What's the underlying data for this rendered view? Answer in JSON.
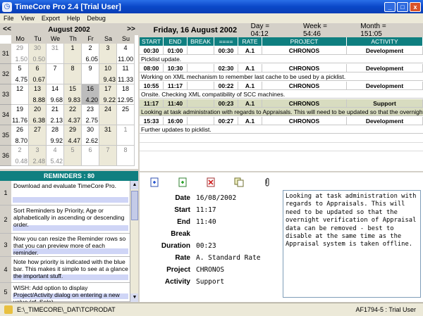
{
  "window": {
    "title": "TimeCore Pro 2.4  [Trial User]",
    "min_glyph": "_",
    "max_glyph": "□",
    "close_glyph": "x"
  },
  "menu": [
    "File",
    "View",
    "Export",
    "Help",
    "Debug"
  ],
  "calendar": {
    "prev": "<<",
    "next": ">>",
    "month": "August 2002",
    "dow": [
      "Mo",
      "Tu",
      "We",
      "Th",
      "Fr",
      "Sa",
      "Su"
    ],
    "weeks": [
      {
        "num": "31",
        "days": [
          {
            "d": "29",
            "h": "1.50",
            "other": true
          },
          {
            "d": "30",
            "h": "0.50",
            "other": true
          },
          {
            "d": "31",
            "h": "",
            "other": true
          },
          {
            "d": "1",
            "h": ""
          },
          {
            "d": "2",
            "h": "6.05"
          },
          {
            "d": "3",
            "h": ""
          },
          {
            "d": "4",
            "h": "11.00"
          }
        ]
      },
      {
        "num": "32",
        "days": [
          {
            "d": "5",
            "h": "4.75"
          },
          {
            "d": "6",
            "h": "0.67"
          },
          {
            "d": "7",
            "h": ""
          },
          {
            "d": "8",
            "h": ""
          },
          {
            "d": "9",
            "h": ""
          },
          {
            "d": "10",
            "h": "9.43"
          },
          {
            "d": "11",
            "h": "11.33"
          }
        ]
      },
      {
        "num": "33",
        "days": [
          {
            "d": "12",
            "h": ""
          },
          {
            "d": "13",
            "h": "8.88"
          },
          {
            "d": "14",
            "h": "9.68"
          },
          {
            "d": "15",
            "h": "9.83"
          },
          {
            "d": "16",
            "h": "4.20",
            "sel": true
          },
          {
            "d": "17",
            "h": "9.22"
          },
          {
            "d": "18",
            "h": "12.95"
          }
        ]
      },
      {
        "num": "34",
        "days": [
          {
            "d": "19",
            "h": "11.76"
          },
          {
            "d": "20",
            "h": "6.38"
          },
          {
            "d": "21",
            "h": "2.13"
          },
          {
            "d": "22",
            "h": "4.37"
          },
          {
            "d": "23",
            "h": "2.75"
          },
          {
            "d": "24",
            "h": ""
          },
          {
            "d": "25",
            "h": ""
          }
        ]
      },
      {
        "num": "35",
        "days": [
          {
            "d": "26",
            "h": "8.70"
          },
          {
            "d": "27",
            "h": ""
          },
          {
            "d": "28",
            "h": "9.92"
          },
          {
            "d": "29",
            "h": "4.47"
          },
          {
            "d": "30",
            "h": "2.62"
          },
          {
            "d": "31",
            "h": ""
          },
          {
            "d": "1",
            "h": "",
            "other": true
          }
        ]
      },
      {
        "num": "36",
        "days": [
          {
            "d": "2",
            "h": "0.48",
            "other": true
          },
          {
            "d": "3",
            "h": "2.48",
            "other": true
          },
          {
            "d": "4",
            "h": "5.42",
            "other": true
          },
          {
            "d": "5",
            "h": "",
            "other": true
          },
          {
            "d": "6",
            "h": "",
            "other": true
          },
          {
            "d": "7",
            "h": "",
            "other": true
          },
          {
            "d": "8",
            "h": "",
            "other": true
          }
        ]
      }
    ]
  },
  "reminders": {
    "header": "REMINDERS : 80",
    "items": [
      {
        "num": "1",
        "text": "Download and evaluate TimeCore Pro."
      },
      {
        "num": "2",
        "text": "Sort Reminders by Priority, Age or alphabetically in ascending or descending order."
      },
      {
        "num": "3",
        "text": "Now you can resize the Reminder rows so that you can preview more of each reminder."
      },
      {
        "num": "4",
        "text": "Note how priority is indicated with the blue bar. This makes it simple to see at a glance the important stuff."
      },
      {
        "num": "5",
        "text": "WISH: Add option to display Project/Activity dialog on entering a new value (cf. Solo)."
      }
    ]
  },
  "day": {
    "date": "Friday, 16 August 2002",
    "day_total": "Day = 04:12",
    "week_total": "Week = 54:46",
    "month_total": "Month = 151:05"
  },
  "entries": {
    "columns": [
      "START",
      "END",
      "BREAK",
      "====",
      "RATE",
      "PROJECT",
      "ACTIVITY"
    ],
    "rows": [
      {
        "start": "00:30",
        "end": "01:00",
        "break": "",
        "dur": "00:30",
        "rate": "A.1",
        "project": "CHRONOS",
        "activity": "Development",
        "desc": "Picklist update."
      },
      {
        "start": "08:00",
        "end": "10:30",
        "break": "",
        "dur": "02:30",
        "rate": "A.1",
        "project": "CHRONOS",
        "activity": "Development",
        "desc": "Working on XML mechanism to remember last cache to be used by a picklist."
      },
      {
        "start": "10:55",
        "end": "11:17",
        "break": "",
        "dur": "00:22",
        "rate": "A.1",
        "project": "CHRONOS",
        "activity": "Development",
        "desc": "Onsite. Checking XML compatibility of SCC machines."
      },
      {
        "start": "11:17",
        "end": "11:40",
        "break": "",
        "dur": "00:23",
        "rate": "A.1",
        "project": "CHRONOS",
        "activity": "Support",
        "desc": "Looking at task administration with regards to Appraisals. This will need to be updated so that the overnight v",
        "sel": true
      },
      {
        "start": "15:33",
        "end": "16:00",
        "break": "",
        "dur": "00:27",
        "rate": "A.1",
        "project": "CHRONOS",
        "activity": "Development",
        "desc": "Further updates to picklist."
      }
    ]
  },
  "toolbar": [
    "new-entry-icon",
    "add-entry-icon",
    "delete-entry-icon",
    "copy-entry-icon",
    "attach-icon"
  ],
  "detail": {
    "labels": [
      "Date",
      "Start",
      "End",
      "Break",
      "Duration",
      "Rate",
      "Project",
      "Activity"
    ],
    "values": [
      "16/08/2002",
      "11:17",
      "11:40",
      "",
      "00:23",
      "A. Standard Rate",
      "CHRONOS",
      "Support"
    ],
    "notes": "Looking at task administration with regards to Appraisals. This will need to be updated so that the overnight verification of Appraisal data can be removed - best to disable at the same time as the Appraisal system is taken offline."
  },
  "status": {
    "path": "E:\\_TIMECORE\\_DAT\\TCPRODAT",
    "license": "AF1794-5 : Trial User"
  },
  "colors": {
    "teal_header": "#0f7f80",
    "title_blue": "#0a48c8",
    "priority_bar": "#cfd5f6",
    "selected_row": "#d8dcc0"
  }
}
